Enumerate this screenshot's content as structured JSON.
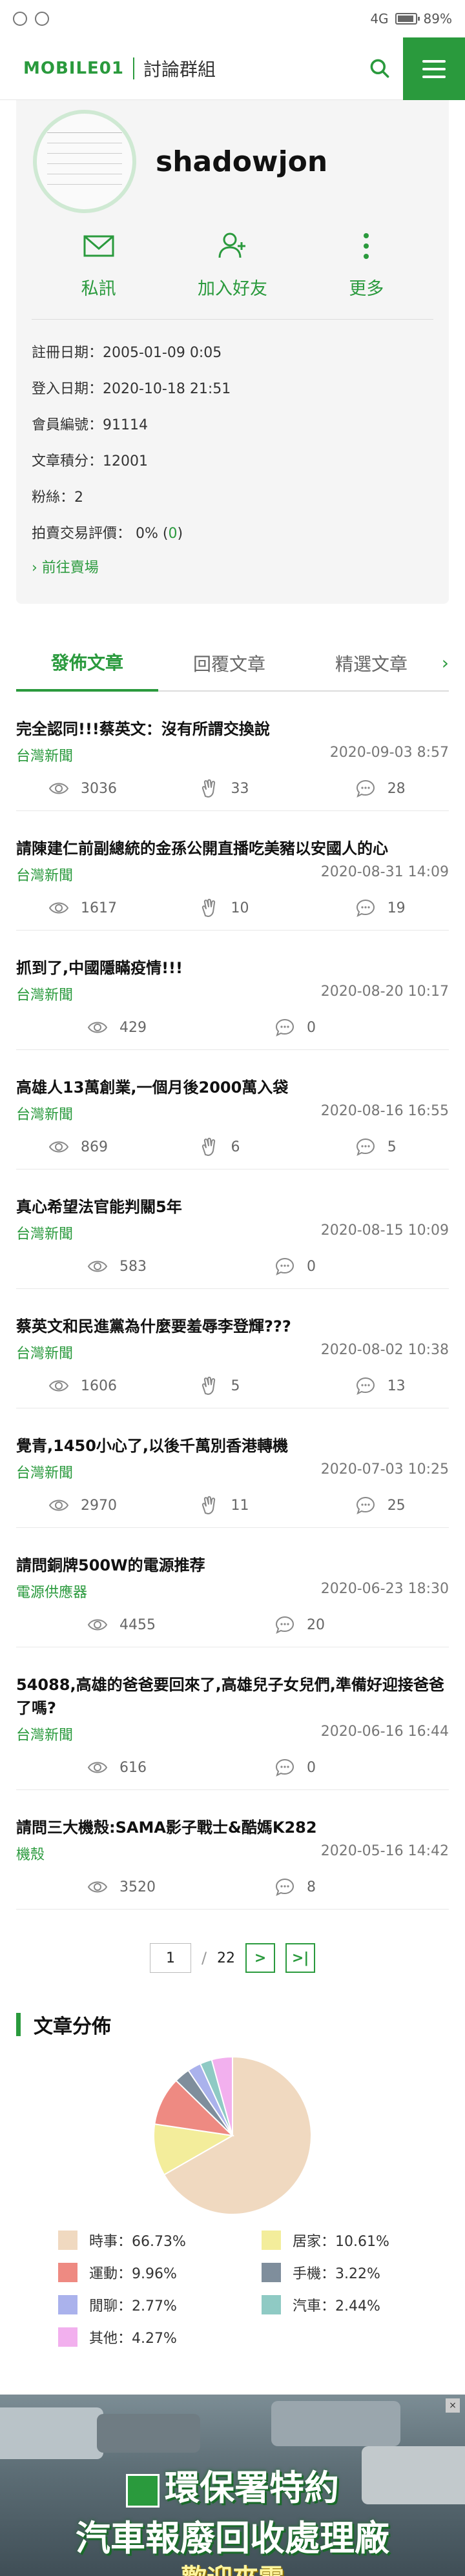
{
  "status_bar": {
    "network": "4G",
    "battery": "89%"
  },
  "header": {
    "logo": "MOBILE01",
    "title": "討論群組"
  },
  "profile": {
    "username": "shadowjon",
    "actions": [
      {
        "label": "私訊",
        "icon": "mail-icon"
      },
      {
        "label": "加入好友",
        "icon": "add-friend-icon"
      },
      {
        "label": "更多",
        "icon": "more-icon"
      }
    ],
    "info": {
      "register": "註冊日期：2005-01-09 0:05",
      "login": "登入日期：2020-10-18 21:51",
      "member_id": "會員編號：91114",
      "points": "文章積分：12001",
      "fans": "粉絲：2",
      "auction_prefix": "拍賣交易評價： 0% (",
      "auction_zero": "0",
      "auction_suffix": ")"
    },
    "shop_link": "前往賣場"
  },
  "tabs": [
    "發佈文章",
    "回覆文章",
    "精選文章"
  ],
  "posts": [
    {
      "title": "完全認同!!!蔡英文：沒有所謂交換說",
      "category": "台灣新聞",
      "date": "2020-09-03 8:57",
      "views": "3036",
      "likes": "33",
      "replies": "28"
    },
    {
      "title": "請陳建仁前副總統的金孫公開直播吃美豬以安國人的心",
      "category": "台灣新聞",
      "date": "2020-08-31 14:09",
      "views": "1617",
      "likes": "10",
      "replies": "19"
    },
    {
      "title": "抓到了,中國隱瞞疫情!!!",
      "category": "台灣新聞",
      "date": "2020-08-20 10:17",
      "views": "429",
      "likes": "",
      "replies": "0"
    },
    {
      "title": "高雄人13萬創業,一個月後2000萬入袋",
      "category": "台灣新聞",
      "date": "2020-08-16 16:55",
      "views": "869",
      "likes": "6",
      "replies": "5"
    },
    {
      "title": "真心希望法官能判關5年",
      "category": "台灣新聞",
      "date": "2020-08-15 10:09",
      "views": "583",
      "likes": "",
      "replies": "0"
    },
    {
      "title": "蔡英文和民進黨為什麼要羞辱李登輝???",
      "category": "台灣新聞",
      "date": "2020-08-02 10:38",
      "views": "1606",
      "likes": "5",
      "replies": "13"
    },
    {
      "title": "覺青,1450小心了,以後千萬別香港轉機",
      "category": "台灣新聞",
      "date": "2020-07-03 10:25",
      "views": "2970",
      "likes": "11",
      "replies": "25"
    },
    {
      "title": "請問銅牌500W的電源推荐",
      "category": "電源供應器",
      "date": "2020-06-23 18:30",
      "views": "4455",
      "likes": "",
      "replies": "20"
    },
    {
      "title": "54088,高雄的爸爸要回來了,高雄兒子女兒們,準備好迎接爸爸了嗎?",
      "category": "台灣新聞",
      "date": "2020-06-16 16:44",
      "views": "616",
      "likes": "",
      "replies": "0"
    },
    {
      "title": "請問三大機殼:SAMA影子戰士&酷媽K282",
      "category": "機殼",
      "date": "2020-05-16 14:42",
      "views": "3520",
      "likes": "",
      "replies": "8"
    }
  ],
  "pagination": {
    "current": "1",
    "separator": "/",
    "total": "22",
    "next": ">",
    "last": ">|"
  },
  "distribution": {
    "title": "文章分佈",
    "legend": [
      {
        "label": "時事：66.73%",
        "color": "#f0d9c0"
      },
      {
        "label": "居家：10.61%",
        "color": "#f3ed9b"
      },
      {
        "label": "運動：9.96%",
        "color": "#ee8a82"
      },
      {
        "label": "手機：3.22%",
        "color": "#7f8e9c"
      },
      {
        "label": "閒聊：2.77%",
        "color": "#aab2ec"
      },
      {
        "label": "汽車：2.44%",
        "color": "#8fcac4"
      },
      {
        "label": "其他：4.27%",
        "color": "#f2b0ee"
      }
    ]
  },
  "chart_data": {
    "type": "pie",
    "title": "文章分佈",
    "categories": [
      "時事",
      "居家",
      "運動",
      "手機",
      "閒聊",
      "汽車",
      "其他"
    ],
    "values": [
      66.73,
      10.61,
      9.96,
      3.22,
      2.77,
      2.44,
      4.27
    ],
    "colors": [
      "#f0d9c0",
      "#f3ed9b",
      "#ee8a82",
      "#7f8e9c",
      "#aab2ec",
      "#8fcac4",
      "#f2b0ee"
    ],
    "legend": "bottom"
  },
  "ad": {
    "line1": "環保署特約",
    "line2": "汽車報廢回收處理廠",
    "line3": "歡迎來電"
  }
}
